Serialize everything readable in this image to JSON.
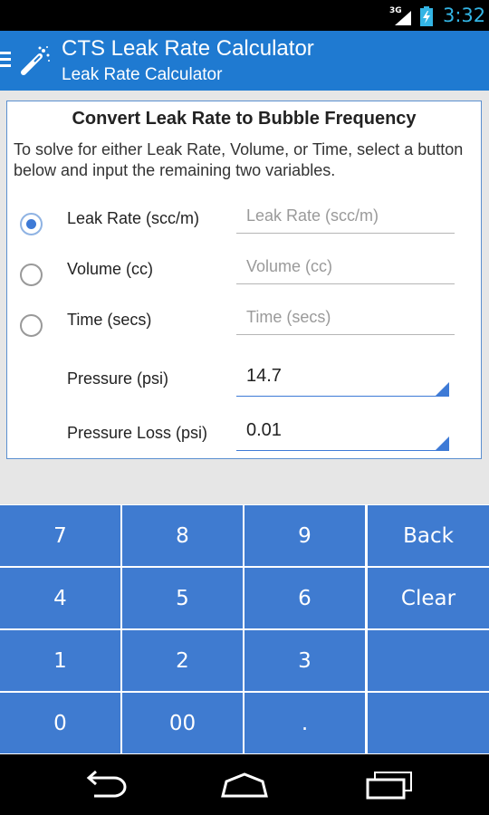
{
  "status_bar": {
    "network": "3G",
    "time": "3:32"
  },
  "action_bar": {
    "title": "CTS Leak Rate Calculator",
    "subtitle": "Leak Rate Calculator"
  },
  "card": {
    "heading": "Convert Leak Rate to Bubble Frequency",
    "instructions": "To solve for either Leak Rate, Volume, or Time, select a button below and input the remaining two variables.",
    "rows": [
      {
        "label": "Leak Rate (scc/m)",
        "placeholder": "Leak Rate (scc/m)",
        "selected": true
      },
      {
        "label": "Volume (cc)",
        "placeholder": "Volume (cc)",
        "selected": false
      },
      {
        "label": "Time (secs)",
        "placeholder": "Time (secs)",
        "selected": false
      }
    ],
    "pressure": {
      "label": "Pressure (psi)",
      "value": "14.7"
    },
    "pressure_loss": {
      "label": "Pressure Loss (psi)",
      "value": "0.01"
    }
  },
  "keypad": {
    "keys": [
      "7",
      "8",
      "9",
      "Back",
      "4",
      "5",
      "6",
      "Clear",
      "1",
      "2",
      "3",
      "",
      "0",
      "00",
      ".",
      ""
    ]
  },
  "colors": {
    "action_bar": "#1f7ad1",
    "key": "#3f7bd0",
    "clock": "#33b5e5"
  },
  "icons": {
    "menu": "hamburger-icon",
    "app": "wand-icon",
    "back": "back-arrow-icon",
    "home": "home-icon",
    "recents": "recent-apps-icon"
  }
}
